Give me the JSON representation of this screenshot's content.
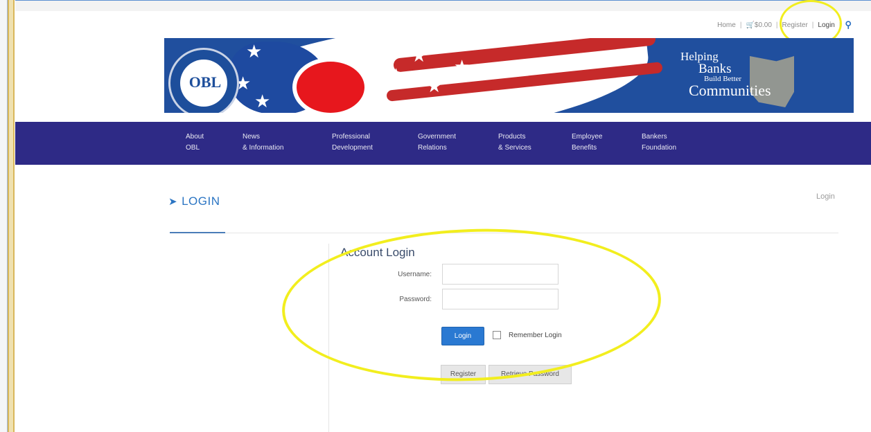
{
  "utility_nav": {
    "home": "Home",
    "cart": "$0.00",
    "register": "Register",
    "login": "Login"
  },
  "banner": {
    "seal_text": "OBL",
    "tagline": [
      "Helping",
      "Banks",
      "Build Better",
      "Communities"
    ]
  },
  "main_nav": [
    {
      "line1": "About",
      "line2": "OBL"
    },
    {
      "line1": "News",
      "line2": "& Information"
    },
    {
      "line1": "Professional",
      "line2": "Development"
    },
    {
      "line1": "Government",
      "line2": "Relations"
    },
    {
      "line1": "Products",
      "line2": "& Services"
    },
    {
      "line1": "Employee",
      "line2": "Benefits"
    },
    {
      "line1": "Bankers",
      "line2": "Foundation"
    }
  ],
  "page": {
    "title": "LOGIN",
    "breadcrumb": "Login"
  },
  "login_form": {
    "heading": "Account Login",
    "username_label": "Username:",
    "username_value": "",
    "password_label": "Password:",
    "password_value": "",
    "login_button": "Login",
    "remember_label": "Remember Login",
    "remember_checked": false,
    "register_button": "Register",
    "retrieve_button": "Retrieve Password"
  },
  "colors": {
    "nav_bg": "#2e2a86",
    "link_blue": "#2b75c3",
    "button_blue": "#2a79d2",
    "annotation_yellow": "#f2ee1e"
  },
  "icons": [
    "cart-icon",
    "search-icon",
    "paper-plane-icon"
  ]
}
